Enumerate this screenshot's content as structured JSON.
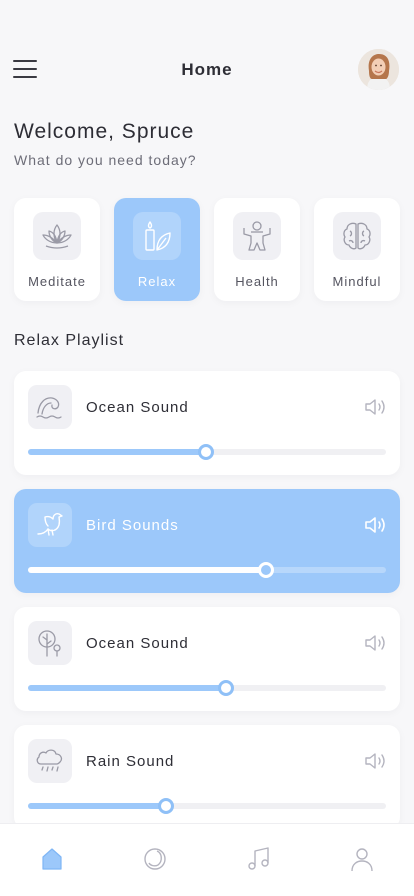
{
  "header": {
    "title": "Home"
  },
  "welcome": {
    "title": "Welcome, Spruce",
    "subtitle": "What do you need today?"
  },
  "categories": [
    {
      "label": "Meditate",
      "icon": "lotus-icon",
      "active": false
    },
    {
      "label": "Relax",
      "icon": "candle-leaf-icon",
      "active": true
    },
    {
      "label": "Health",
      "icon": "person-icon",
      "active": false
    },
    {
      "label": "Mindful",
      "icon": "brain-icon",
      "active": false
    }
  ],
  "playlist": {
    "title": "Relax Playlist",
    "tracks": [
      {
        "name": "Ocean Sound",
        "icon": "wave-icon",
        "progress": 0.496,
        "active": false
      },
      {
        "name": "Bird Sounds",
        "icon": "bird-icon",
        "progress": 0.665,
        "active": true
      },
      {
        "name": "Ocean Sound",
        "icon": "tree-icon",
        "progress": 0.553,
        "active": false
      },
      {
        "name": "Rain Sound",
        "icon": "rain-cloud-icon",
        "progress": 0.386,
        "active": false
      }
    ]
  },
  "tabbar": {
    "items": [
      {
        "icon": "home-icon",
        "active": true
      },
      {
        "icon": "moon-icon",
        "active": false
      },
      {
        "icon": "music-note-icon",
        "active": false
      },
      {
        "icon": "profile-icon",
        "active": false
      }
    ]
  },
  "colors": {
    "accent": "#9cc8fa",
    "background": "#f7f7f9",
    "card": "#ffffff",
    "text": "#2d2d35"
  }
}
